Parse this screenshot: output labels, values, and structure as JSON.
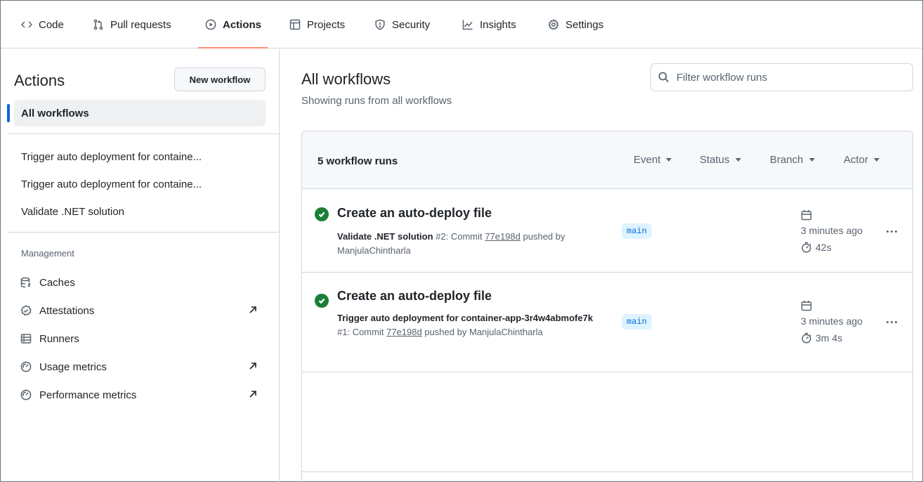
{
  "nav": {
    "tabs": [
      {
        "label": "Code",
        "icon": "code-icon"
      },
      {
        "label": "Pull requests",
        "icon": "pull-request-icon"
      },
      {
        "label": "Actions",
        "icon": "play-icon",
        "active": true
      },
      {
        "label": "Projects",
        "icon": "table-icon"
      },
      {
        "label": "Security",
        "icon": "shield-icon"
      },
      {
        "label": "Insights",
        "icon": "graph-icon"
      },
      {
        "label": "Settings",
        "icon": "gear-icon"
      }
    ],
    "active_underline_color": "#fd8c73"
  },
  "sidebar": {
    "title": "Actions",
    "new_workflow_label": "New workflow",
    "all_workflows_label": "All workflows",
    "workflows": [
      "Trigger auto deployment for containe...",
      "Trigger auto deployment for containe...",
      "Validate .NET solution"
    ],
    "management_heading": "Management",
    "management_items": [
      {
        "label": "Caches",
        "icon": "database-icon",
        "external": false
      },
      {
        "label": "Attestations",
        "icon": "verified-icon",
        "external": true
      },
      {
        "label": "Runners",
        "icon": "server-icon",
        "external": false
      },
      {
        "label": "Usage metrics",
        "icon": "meter-icon",
        "external": true
      },
      {
        "label": "Performance metrics",
        "icon": "meter-icon",
        "external": true
      }
    ]
  },
  "main": {
    "title": "All workflows",
    "subtitle": "Showing runs from all workflows",
    "filter_placeholder": "Filter workflow runs",
    "runs_count": "5 workflow runs",
    "filters": [
      "Event",
      "Status",
      "Branch",
      "Actor"
    ],
    "runs": [
      {
        "title": "Create an auto-deploy file",
        "workflow": "Validate .NET solution",
        "run_number": "#2",
        "commit_prefix": ": Commit",
        "sha": "77e198d",
        "pushed_by": "pushed by",
        "actor": "ManjulaChintharla",
        "branch": "main",
        "time_ago": "3 minutes ago",
        "duration": "42s",
        "status": "success"
      },
      {
        "title": "Create an auto-deploy file",
        "workflow": "Trigger auto deployment for container-app-3r4w4abmofe7k",
        "run_number": "#1",
        "commit_prefix": ": Commit",
        "sha": "77e198d",
        "pushed_by": "pushed by",
        "actor": "ManjulaChintharla",
        "branch": "main",
        "time_ago": "3 minutes ago",
        "duration": "3m 4s",
        "status": "success"
      }
    ]
  },
  "colors": {
    "accent": "#0969da",
    "success": "#1a7f37",
    "branch_bg": "#ddf4ff"
  }
}
